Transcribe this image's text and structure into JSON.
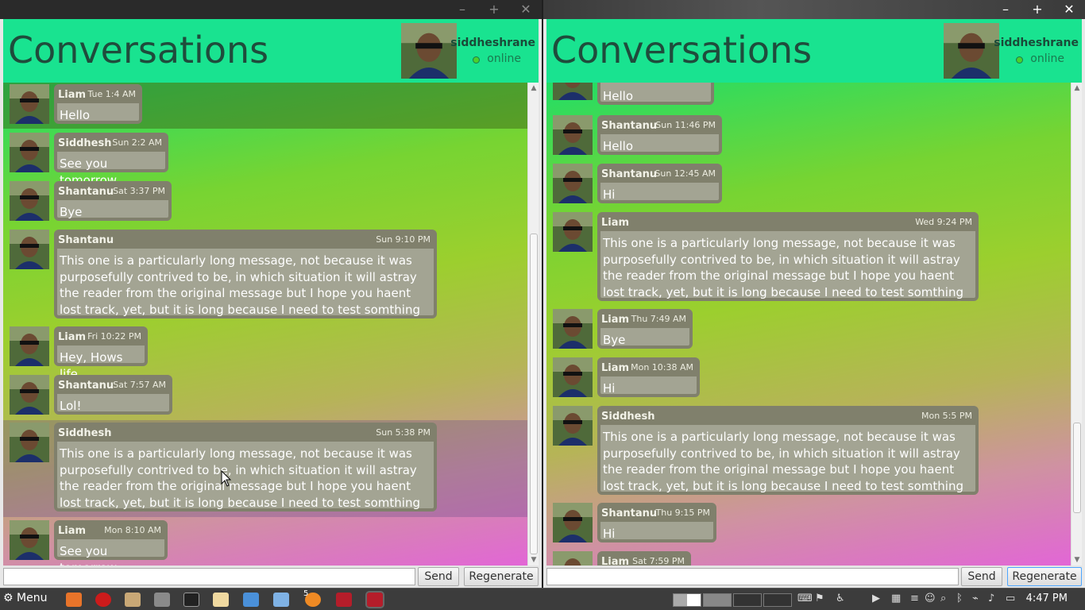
{
  "app": {
    "title": "Conversations"
  },
  "user": {
    "name": "siddheshrane",
    "status": "online"
  },
  "buttons": {
    "send": "Send",
    "regenerate": "Regenerate"
  },
  "colors": {
    "header": "#19e390",
    "bubble": "#a3a493",
    "bubble_header": "#80806c"
  },
  "left": {
    "messages": [
      {
        "sender": "Liam",
        "time": "Tue 1:4 AM",
        "text": "Hello"
      },
      {
        "sender": "Siddhesh",
        "time": "Sun 2:2 AM",
        "text": "See you tomorrow"
      },
      {
        "sender": "Shantanu",
        "time": "Sat 3:37 PM",
        "text": "Bye"
      },
      {
        "sender": "Shantanu",
        "time": "Sun 9:10 PM",
        "text": "This one is a particularly long message, not because it was purposefully contrived to be, in which situation it will astray the reader from the original message but I hope you haent lost track, yet, but it is long because I need to test somthing"
      },
      {
        "sender": "Liam",
        "time": "Fri 10:22 PM",
        "text": "Hey, Hows life"
      },
      {
        "sender": "Shantanu",
        "time": "Sat 7:57 AM",
        "text": "Lol!"
      },
      {
        "sender": "Siddhesh",
        "time": "Sun 5:38 PM",
        "text": "This one is a particularly long message, not because it was purposefully contrived to be, in which situation it will astray the reader from the original message but I hope you haent lost track, yet, but it is long because I need to test somthing"
      },
      {
        "sender": "Liam",
        "time": "Mon 8:10 AM",
        "text": "See you tomorrow"
      }
    ]
  },
  "right": {
    "messages": [
      {
        "sender": "",
        "time": "",
        "text": "Hello"
      },
      {
        "sender": "Shantanu",
        "time": "Sun 11:46 PM",
        "text": "Hello"
      },
      {
        "sender": "Shantanu",
        "time": "Sun 12:45 AM",
        "text": "Hi"
      },
      {
        "sender": "Liam",
        "time": "Wed 9:24 PM",
        "text": "This one is a particularly long message, not because it was purposefully contrived to be, in which situation it will astray the reader from the original message but I hope you haent lost track, yet, but it is long because I need to test somthing"
      },
      {
        "sender": "Liam",
        "time": "Thu 7:49 AM",
        "text": "Bye"
      },
      {
        "sender": "Liam",
        "time": "Mon 10:38 AM",
        "text": "Hi"
      },
      {
        "sender": "Siddhesh",
        "time": "Mon 5:5 PM",
        "text": "This one is a particularly long message, not because it was purposefully contrived to be, in which situation it will astray the reader from the original message but I hope you haent lost track, yet, but it is long because I need to test somthing"
      },
      {
        "sender": "Shantanu",
        "time": "Thu 9:15 PM",
        "text": "Hi"
      },
      {
        "sender": "Liam",
        "time": "Sat 7:59 PM",
        "text": ""
      }
    ]
  },
  "taskbar": {
    "menu": "Menu",
    "clock": "4:47 PM",
    "badge": "5"
  }
}
